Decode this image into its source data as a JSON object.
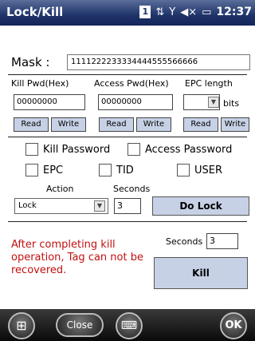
{
  "titlebar": {
    "title": "Lock/Kill",
    "sim_badge": "1",
    "signal_icon": "signal-icon",
    "volume_icon": "volume-mute-icon",
    "battery_icon": "battery-icon",
    "time": "12:37"
  },
  "mask": {
    "label": "Mask :",
    "value": "1111222233334444555566666"
  },
  "fields": {
    "kill_label": "Kill Pwd(Hex)",
    "access_label": "Access Pwd(Hex)",
    "epc_label": "EPC length",
    "kill_value": "00000000",
    "access_value": "00000000",
    "epc_value": "",
    "bits_label": "bits",
    "read_label": "Read",
    "write_label": "Write"
  },
  "checks": {
    "kill_password": "Kill Password",
    "access_password": "Access Password",
    "epc": "EPC",
    "tid": "TID",
    "user": "USER"
  },
  "lock": {
    "action_label": "Action",
    "seconds_label": "Seconds",
    "action_value": "Lock",
    "seconds_value": "3",
    "do_lock_label": "Do Lock"
  },
  "kill": {
    "warning": "After completing kill operation, Tag can not be recovered.",
    "seconds_label": "Seconds",
    "seconds_value": "3",
    "kill_label": "Kill"
  },
  "softkeys": {
    "start_icon": "windows-start-icon",
    "close_label": "Close",
    "keyboard_icon": "keyboard-icon",
    "ok_label": "OK"
  }
}
